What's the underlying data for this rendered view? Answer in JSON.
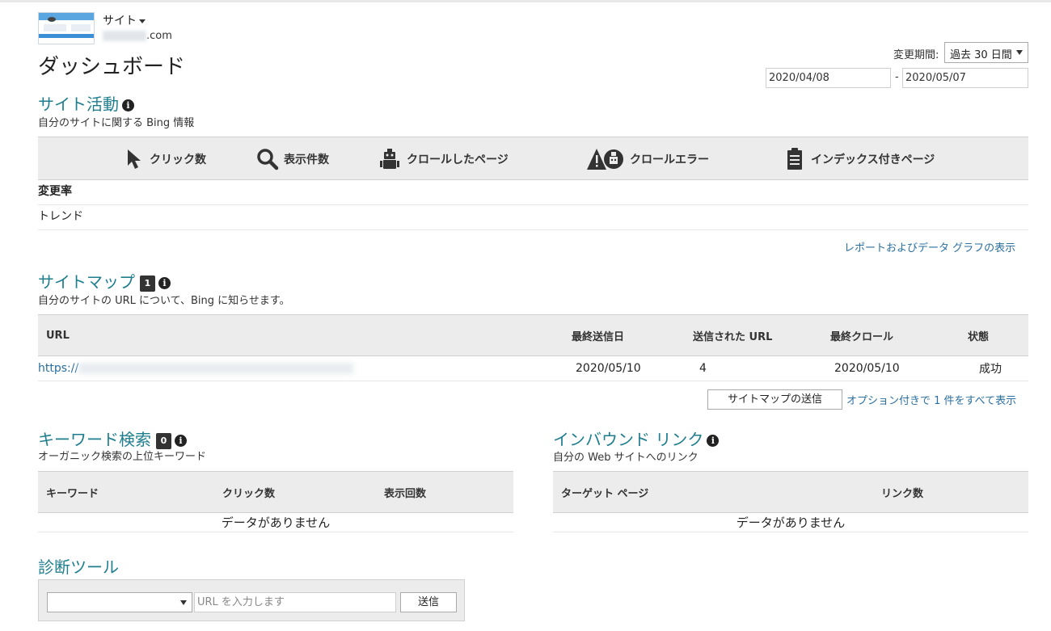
{
  "header": {
    "site_label": "サイト",
    "site_domain_suffix": ".com",
    "page_title": "ダッシュボード",
    "period_label": "変更期間:",
    "period_value": "過去 30 日間",
    "date_from": "2020/04/08",
    "date_separator": "-",
    "date_to": "2020/05/07"
  },
  "site_activity": {
    "title": "サイト活動",
    "subtitle": "自分のサイトに関する Bing 情報",
    "metrics": [
      {
        "label": "クリック数",
        "icon": "cursor-icon"
      },
      {
        "label": "表示件数",
        "icon": "magnifier-icon"
      },
      {
        "label": "クロールしたページ",
        "icon": "robot-icon"
      },
      {
        "label": "クロールエラー",
        "icon": "crawl-error-icon"
      },
      {
        "label": "インデックス付きページ",
        "icon": "clipboard-icon"
      }
    ],
    "change_rate_label": "変更率",
    "trend_label": "トレンド",
    "report_link": "レポートおよびデータ グラフの表示"
  },
  "sitemaps": {
    "title": "サイトマップ",
    "count": "1",
    "subtitle": "自分のサイトの URL について、Bing に知らせます。",
    "columns": [
      "URL",
      "最終送信日",
      "送信された URL",
      "最終クロール",
      "状態"
    ],
    "rows": [
      {
        "url_prefix": "https://",
        "last_submitted": "2020/05/10",
        "submitted_urls": "4",
        "last_crawled": "2020/05/10",
        "status": "成功"
      }
    ],
    "submit_button": "サイトマップの送信",
    "show_all_link": "オプション付きで 1 件をすべて表示"
  },
  "keywords": {
    "title": "キーワード検索",
    "count": "0",
    "subtitle": "オーガニック検索の上位キーワード",
    "columns": [
      "キーワード",
      "クリック数",
      "表示回数"
    ],
    "empty_text": "データがありません"
  },
  "inbound_links": {
    "title": "インバウンド リンク",
    "subtitle": "自分の Web サイトへのリンク",
    "columns": [
      "ターゲット ページ",
      "リンク数"
    ],
    "empty_text": "データがありません"
  },
  "diagnostics": {
    "title": "診断ツール",
    "url_placeholder": "URL を入力します",
    "submit_button": "送信"
  }
}
